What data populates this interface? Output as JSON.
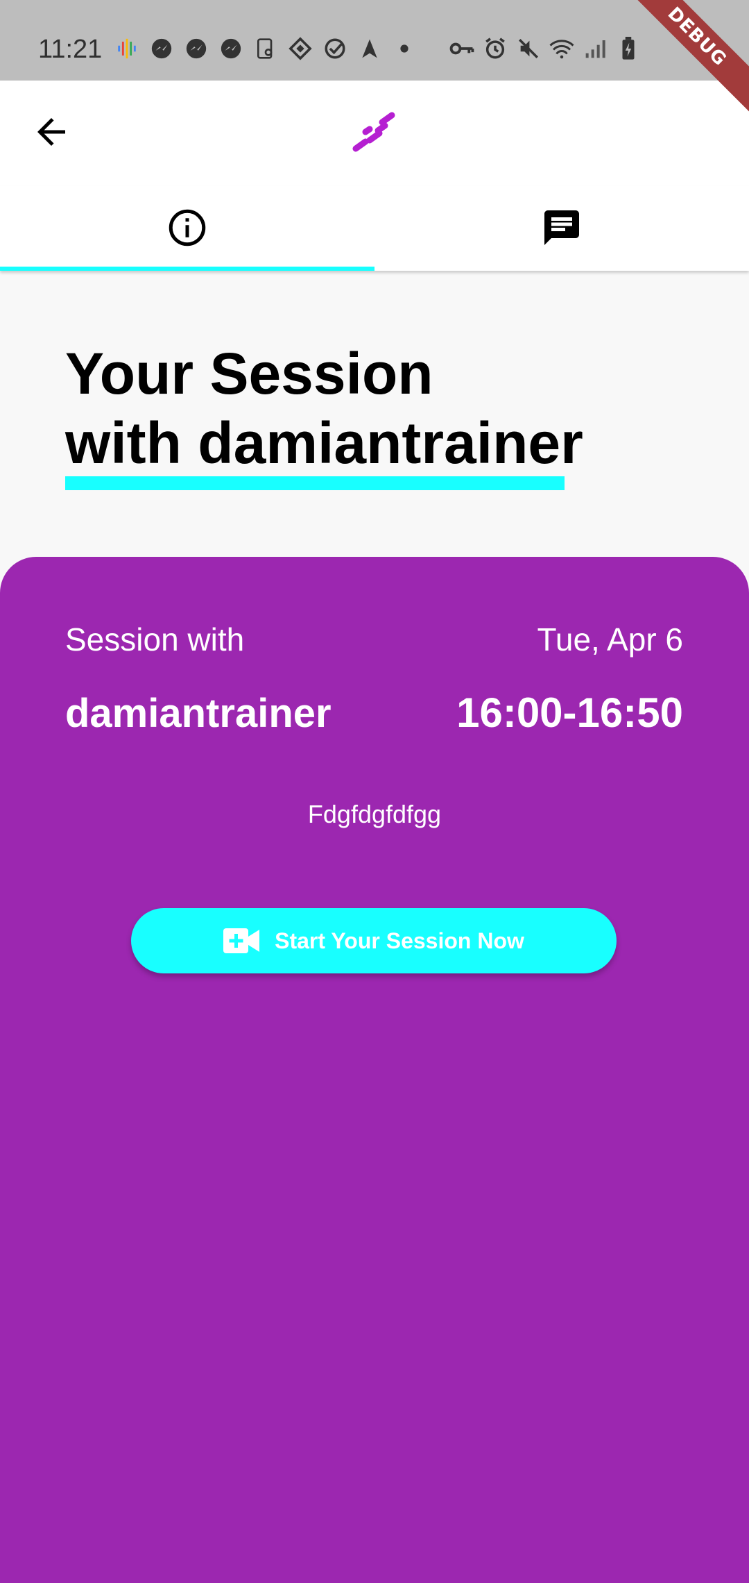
{
  "status_bar": {
    "time": "11:21",
    "left_icons": [
      "podcasts-icon",
      "messenger-icon",
      "messenger-icon",
      "messenger-icon",
      "scanner-icon",
      "binance-icon",
      "check-circle-icon",
      "navigation-icon",
      "dot-icon"
    ],
    "right_icons": [
      "key-icon",
      "alarm-icon",
      "mute-icon",
      "wifi-icon",
      "signal-icon",
      "battery-charging-icon"
    ]
  },
  "debug_banner": "DEBUG",
  "app_bar": {
    "back_icon": "arrow-back-icon",
    "logo_icon": "brand-logo-icon",
    "logo_color": "#b51fd1"
  },
  "tabs": [
    {
      "name": "info",
      "icon": "info-icon",
      "selected": true
    },
    {
      "name": "messages",
      "icon": "message-icon",
      "selected": false
    }
  ],
  "colors": {
    "accent": "#18ffff",
    "card": "#9c27b0",
    "background": "#f8f8f8"
  },
  "heading": {
    "line1": "Your Session",
    "line2": "with damiantrainer"
  },
  "session": {
    "label": "Session with",
    "date": "Tue, Apr 6",
    "trainer": "damiantrainer",
    "time": "16:00-16:50",
    "description": "Fdgfdgfdfgg"
  },
  "start_button": {
    "icon": "video-call-icon",
    "label": "Start Your Session Now"
  }
}
